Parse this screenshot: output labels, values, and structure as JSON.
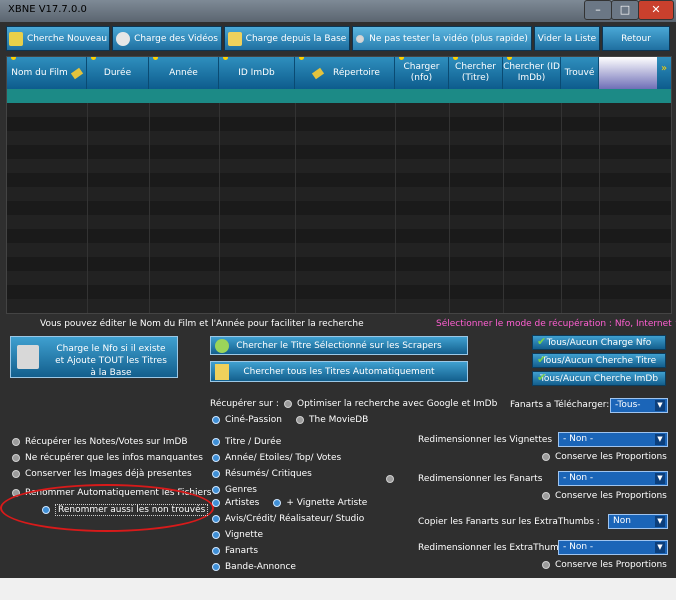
{
  "window": {
    "title": "XBNE V17.7.0.0",
    "controls": {
      "minimize": "–",
      "maximize": "□",
      "close": "✕"
    }
  },
  "toolbar": {
    "chercher_nouveau": "Cherche Nouveau",
    "charge_videos": "Charge des Vidéos",
    "charge_base": "Charge depuis la Base",
    "ne_pas_tester": "Ne pas tester la vidéo (plus rapide)",
    "vider_liste": "Vider la Liste",
    "retour": "Retour"
  },
  "grid": {
    "columns": [
      "Nom du Film",
      "Durée",
      "Année",
      "ID ImDb",
      "Répertoire",
      "Charger (nfo)",
      "Chercher (Titre)",
      "Chercher (ID ImDb)",
      "Trouvé"
    ]
  },
  "panel": {
    "hint": "Vous pouvez éditer le Nom du Film et l'Année pour faciliter la recherche",
    "mode_hint": "Sélectionner le mode de récupération : Nfo, Internet ^",
    "charge_nfo_btn": "Charge le Nfo si il existe et Ajoute TOUT les Titres à la Base",
    "chercher_titre_sel": "Chercher le Titre Sélectionné sur les Scrapers",
    "chercher_tous": "Chercher tous les Titres Automatiquement",
    "tous_nfo": "Tous/Aucun Charge Nfo",
    "tous_titre": "Tous/Aucun Cherche Titre",
    "tous_imdb": "Tous/Aucun Cherche ImDb",
    "recuperer_sur": "Récupérer sur :",
    "optimiser": "Optimiser la recherche avec Google et ImDb",
    "cine_passion": "Ciné-Passion",
    "moviedb": "The MovieDB",
    "fanarts_label": "Fanarts a Télécharger:",
    "fanarts_value": "-Tous-",
    "left_options": [
      "Récupérer les Notes/Votes sur ImDB",
      "Ne récupérer que les infos manquantes",
      "Conserver les Images déjà presentes",
      "Renommer Automatiquement les Fichiers"
    ],
    "renommer_non_trouves": "Renommer aussi les non trouvés",
    "middle_options": [
      "Titre / Durée",
      "Année/ Etoiles/ Top/ Votes",
      "Résumés/ Critiques",
      "Genres",
      "Artistes",
      "Avis/Crédit/ Réalisateur/ Studio",
      "Vignette",
      "Fanarts",
      "Bande-Annonce"
    ],
    "vignette_artiste": "+ Vignette Artiste",
    "redim_vignettes": "Redimensionner les Vignettes",
    "redim_fanarts": "Redimensionner les Fanarts",
    "copier_fanarts": "Copier les Fanarts sur les ExtraThumbs :",
    "redim_extrathumbs": "Redimensionner les ExtraThumbs",
    "non_value": "- Non -",
    "non_plain": "Non",
    "conserve": "Conserve les Proportions"
  }
}
